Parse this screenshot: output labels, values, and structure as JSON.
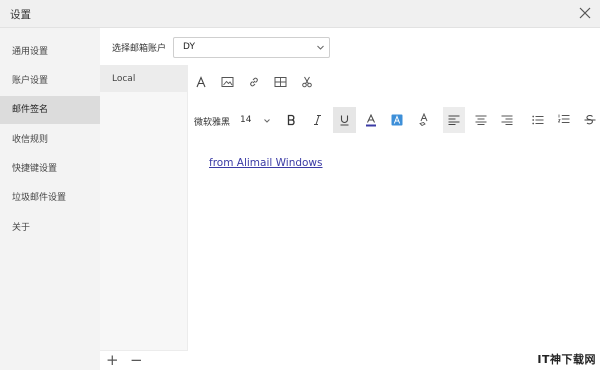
{
  "window": {
    "title": "设置"
  },
  "sidebar": {
    "items": [
      {
        "label": "通用设置"
      },
      {
        "label": "账户设置"
      },
      {
        "label": "邮件签名"
      },
      {
        "label": "收信规则"
      },
      {
        "label": "快捷键设置"
      },
      {
        "label": "垃圾邮件设置"
      },
      {
        "label": "关于"
      }
    ],
    "active_index": 2
  },
  "account": {
    "label": "选择邮箱账户",
    "value": "DY"
  },
  "signatures": {
    "items": [
      {
        "label": "Local"
      }
    ],
    "add_label": "+",
    "remove_label": "−"
  },
  "format_toolbar": {
    "font_name": "微软雅黑",
    "font_size": "14"
  },
  "editor": {
    "content": "from Alimail Windows"
  },
  "watermark": "IT神下载网",
  "colors": {
    "accent": "#3b3ba5",
    "link": "#3b3ba5",
    "highlight_icon": "#3d8fd8"
  }
}
